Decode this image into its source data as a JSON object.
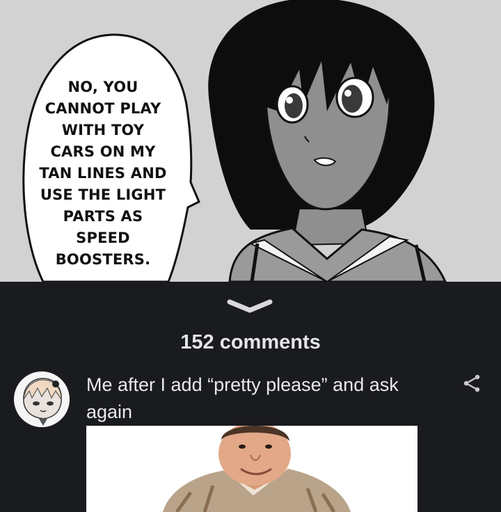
{
  "meme_panel": {
    "speech_lines": [
      "NO, YOU",
      "CANNOT PLAY",
      "WITH TOY",
      "CARS ON MY",
      "TAN LINES AND",
      "USE THE LIGHT",
      "PARTS AS",
      "SPEED",
      "BOOSTERS."
    ]
  },
  "comments": {
    "expand_icon": "chevron-down-icon",
    "count_label": "152 comments",
    "items": [
      {
        "avatar_icon": "anime-avatar",
        "text": "Me after I add “pretty please” and ask again",
        "share_icon": "share-icon",
        "attachment": "reaction-photo"
      }
    ]
  },
  "colors": {
    "background": "#1a1b1f",
    "panel_background": "#d2d2d2",
    "text_primary": "#e8e9ec"
  }
}
